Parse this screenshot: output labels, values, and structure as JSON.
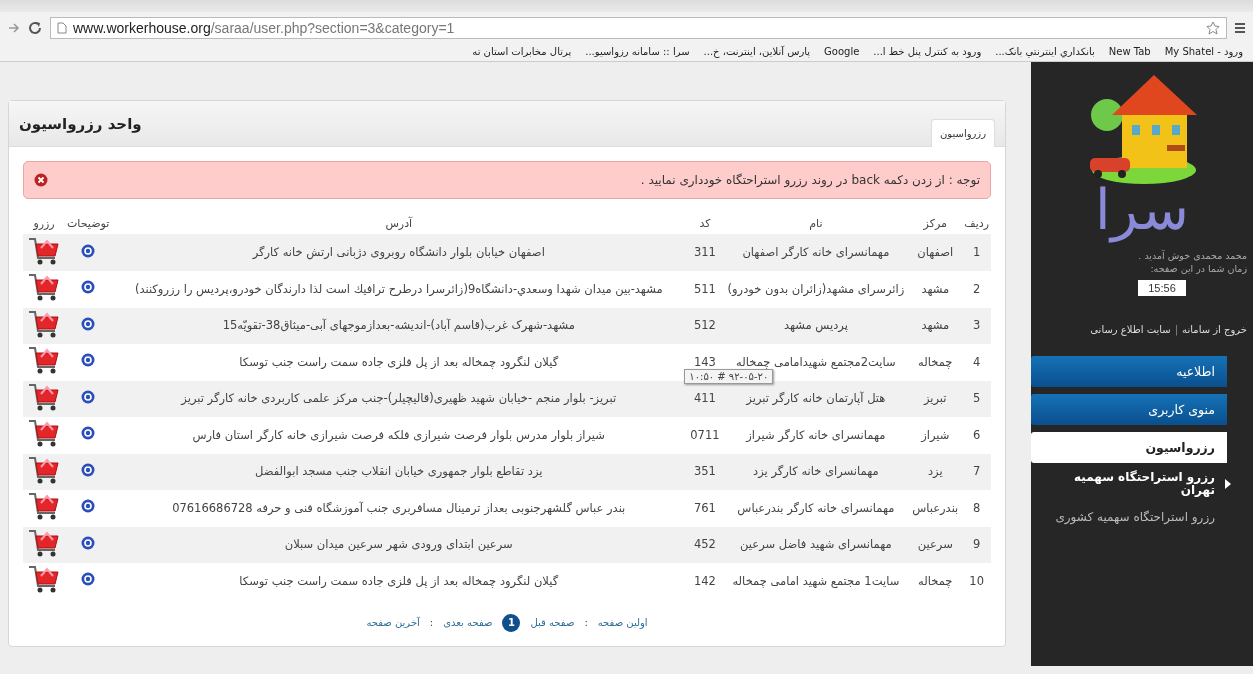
{
  "browser": {
    "url_host": "www.workerhouse.org",
    "url_path": "/saraa/user.php?section=3&category=1",
    "bookmarks": [
      {
        "label": "ورود - My Shatel"
      },
      {
        "label": "New Tab"
      },
      {
        "label": "بانکداري اينترنتي بانک..."
      },
      {
        "label": "ورود به کنترل پنل خط ا..."
      },
      {
        "label": "Google"
      },
      {
        "label": "پارس آنلاین، اینترنت، خ..."
      },
      {
        "label": "سرا :: سامانه رزواسیو..."
      },
      {
        "label": "پرتال مخابرات استان ته"
      }
    ]
  },
  "panel": {
    "title": "واحد رزرواسیون",
    "tabs": [
      {
        "label": "رزرواسیون",
        "selected": true
      }
    ],
    "alert": "توجه : از زدن دکمه back در روند رزرو استراحتگاه خودداری نمایید .",
    "table": {
      "columns": [
        "ردیف",
        "مرکز",
        "نام",
        "کد",
        "آدرس",
        "توضیحات",
        "رزرو"
      ],
      "rows": [
        {
          "no": "1",
          "center": "اصفهان",
          "name": "مهمانسرای خانه کارگر اصفهان",
          "code": "311",
          "address": "اصفهان خیابان بلوار دانشگاه روبروی دژبانی ارتش خانه کارگر"
        },
        {
          "no": "2",
          "center": "مشهد",
          "name": "زائرسرای مشهد(زائران بدون خودرو)",
          "code": "511",
          "address": "مشهد-بین میدان شهدا وسعدي-دانشگاه9(زائرسرا درطرح ترافيك است لذا دارندگان خودرو،پرديس را رزروكنند)"
        },
        {
          "no": "3",
          "center": "مشهد",
          "name": "پردیس مشهد",
          "code": "512",
          "address": "مشهد-شهرک غرب(قاسم آباد)-اندیشه-بعدازموجهای آبی-میثاق38-تقویّه15"
        },
        {
          "no": "4",
          "center": "چمخاله",
          "name": "سایت2مجتمع شهیدامامی چمخاله",
          "code": "143",
          "address": "گیلان لنگرود چمخاله بعد از پل فلزی جاده سمت راست جنب توسکا",
          "tooltip": "۱۰:۵۰ # ۹۲-۰۵-۲۰"
        },
        {
          "no": "5",
          "center": "تبریز",
          "name": "هتل آپارتمان خانه کارگر تبریز",
          "code": "411",
          "address": "تبریز- بلوار منجم -خیابان شهید ظهیری(قالیچیلر)-جنب مرکز علمی کاربردی خانه کارگر تبریز"
        },
        {
          "no": "6",
          "center": "شیراز",
          "name": "مهمانسرای خانه کارگر شیراز",
          "code": "0711",
          "address": "شیراز بلوار مدرس بلوار فرصت شیرازی فلکه فرصت شیرازی خانه کارگر استان فارس"
        },
        {
          "no": "7",
          "center": "یزد",
          "name": "مهمانسرای خانه کارگر یزد",
          "code": "351",
          "address": "یزد تقاطع بلوار جمهوری خیابان انقلاب جنب مسجد ابوالفضل"
        },
        {
          "no": "8",
          "center": "بندرعباس",
          "name": "مهمانسرای خانه کارگر بندرعباس",
          "code": "761",
          "address": "بندر عباس گلشهرجنوبی بعداز ترمینال مسافربری جنب آموزشگاه فنی و حرفه 07616686728"
        },
        {
          "no": "9",
          "center": "سرعین",
          "name": "مهمانسرای شهید فاضل سرعین",
          "code": "452",
          "address": "سرعین ابتدای ورودی شهر سرعین میدان سبلان"
        },
        {
          "no": "10",
          "center": "چمخاله",
          "name": "سایت1 مجتمع شهید امامی چمخاله",
          "code": "142",
          "address": "گیلان لنگرود چمخاله بعد از پل فلزی جاده سمت راست جنب توسکا"
        }
      ]
    },
    "pagination": [
      {
        "kind": "link",
        "label": "اولین صفحه"
      },
      {
        "kind": "sep",
        "label": ":"
      },
      {
        "kind": "link",
        "label": "صفحه قبل"
      },
      {
        "kind": "page",
        "label": "1",
        "selected": true
      },
      {
        "kind": "link",
        "label": "صفحه بعدی"
      },
      {
        "kind": "sep",
        "label": ":"
      },
      {
        "kind": "link",
        "label": "آخرین صفحه"
      }
    ]
  },
  "sidebar": {
    "logo": "سرا",
    "welcome": "محمد محمدی خوش آمدید .",
    "time_label": "زمان شما در این صفحه:",
    "time": "15:56",
    "links": [
      {
        "kind": "link",
        "label": "خروج از سامانه"
      },
      {
        "kind": "sep",
        "label": "|"
      },
      {
        "kind": "link",
        "label": "سایت اطلاع رسانی"
      }
    ],
    "menu": [
      {
        "label": "اطلاعیه",
        "selected": false
      },
      {
        "label": "منوی کاربری",
        "selected": false
      },
      {
        "label": "رزرواسیون",
        "selected": true
      }
    ],
    "submenu": [
      {
        "label": "رزرو استراحتگاه سهمیه تهران",
        "selected": true
      },
      {
        "label": "رزرو استراحتگاه سهمیه کشوری",
        "selected": false
      }
    ]
  }
}
